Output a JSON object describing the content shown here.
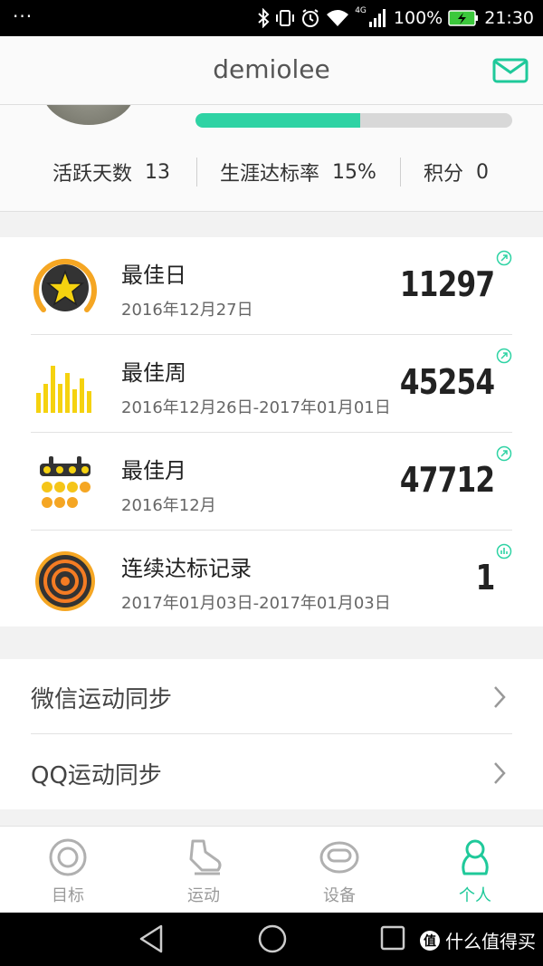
{
  "status_bar": {
    "menu_dots": "···",
    "network": "4G",
    "battery_percent": "100%",
    "time": "21:30"
  },
  "header": {
    "title": "demiolee",
    "mail_icon": "mail-icon"
  },
  "profile": {
    "progress_fraction": 0.52,
    "stats": [
      {
        "label": "活跃天数",
        "value": "13"
      },
      {
        "label": "生涯达标率",
        "value": "15%"
      },
      {
        "label": "积分",
        "value": "0"
      }
    ]
  },
  "records": [
    {
      "name": "最佳日",
      "date": "2016年12月27日",
      "value": "11297",
      "icon": "star-medal-icon",
      "action_icon": "share-icon"
    },
    {
      "name": "最佳周",
      "date": "2016年12月26日-2017年01月01日",
      "value": "45254",
      "icon": "bar-week-icon",
      "action_icon": "share-icon"
    },
    {
      "name": "最佳月",
      "date": "2016年12月",
      "value": "47712",
      "icon": "calendar-icon",
      "action_icon": "share-icon"
    },
    {
      "name": "连续达标记录",
      "date": "2017年01月03日-2017年01月03日",
      "value": "1",
      "icon": "target-rings-icon",
      "action_icon": "chart-icon"
    }
  ],
  "sync": [
    {
      "label": "微信运动同步"
    },
    {
      "label": "QQ运动同步"
    }
  ],
  "tabs": [
    {
      "label": "目标",
      "icon": "target-icon",
      "active": false
    },
    {
      "label": "运动",
      "icon": "shoe-icon",
      "active": false
    },
    {
      "label": "设备",
      "icon": "band-icon",
      "active": false
    },
    {
      "label": "个人",
      "icon": "person-icon",
      "active": true
    }
  ],
  "watermark": {
    "badge": "值",
    "text": "什么值得买"
  },
  "colors": {
    "accent": "#1fc99a",
    "progress_fill": "#2ed3a4",
    "medal_orange": "#f5a623",
    "bar_yellow": "#f5d20f"
  }
}
